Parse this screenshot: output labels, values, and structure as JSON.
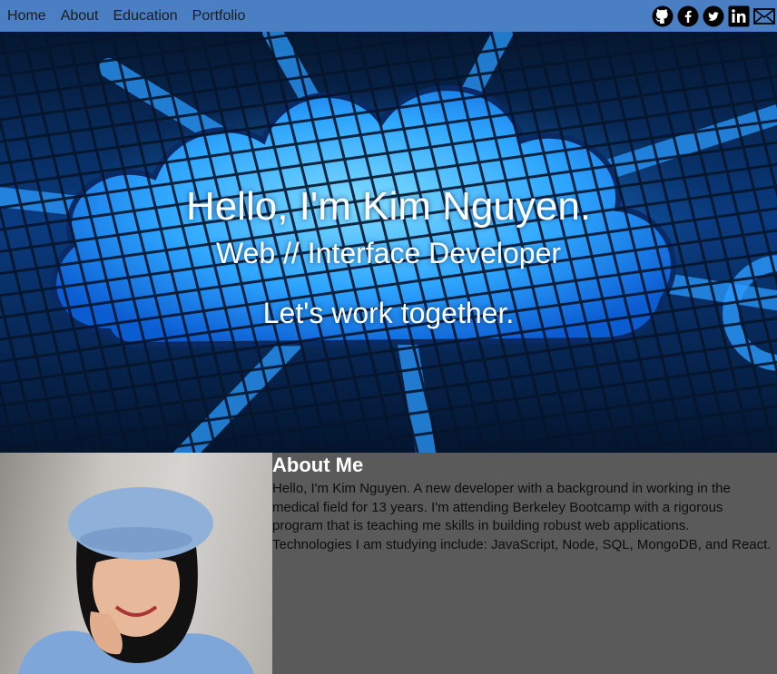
{
  "nav": {
    "links": [
      "Home",
      "About",
      "Education",
      "Portfolio"
    ],
    "social": [
      "github-icon",
      "facebook-icon",
      "twitter-icon",
      "linkedin-icon",
      "mail-icon"
    ]
  },
  "hero": {
    "title": "Hello, I'm Kim Nguyen.",
    "subtitle": "Web // Interface Developer",
    "cta": "Let's work together."
  },
  "about": {
    "heading": "About Me",
    "body": "Hello, I'm Kim Nguyen. A new developer with a background in working in the medical field for 13 years. I'm attending Berkeley Bootcamp with a rigorous program that is teaching me skills in building robust web applications. Technologies I am studying include: JavaScript, Node, SQL, MongoDB, and React."
  },
  "colors": {
    "nav_bg": "#4a7fc4",
    "about_bg": "#5a5a5a",
    "hero_glow": "#2aa8ff"
  }
}
